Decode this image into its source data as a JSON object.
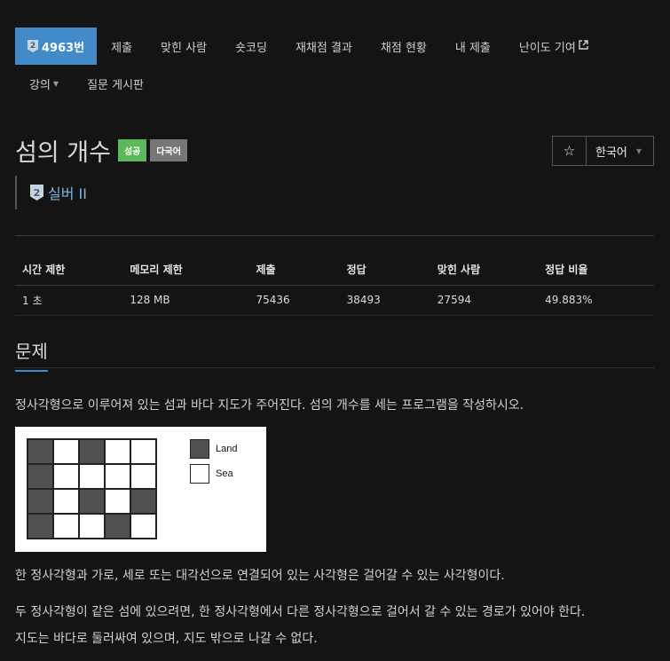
{
  "nav": {
    "problem_number": "4963번",
    "tier_number": "2",
    "items": [
      "제출",
      "맞힌 사람",
      "숏코딩",
      "재채점 결과",
      "채점 현황",
      "내 제출",
      "난이도 기여"
    ],
    "external_icon": "external-link-icon",
    "second_row": [
      "강의",
      "질문 게시판"
    ]
  },
  "title": {
    "text": "섬의 개수",
    "label_success": "성공",
    "label_multi": "다국어"
  },
  "language": {
    "star": "☆",
    "current": "한국어"
  },
  "tier": {
    "badge": "2",
    "name": "실버 II"
  },
  "stats": {
    "headers": [
      "시간 제한",
      "메모리 제한",
      "제출",
      "정답",
      "맞힌 사람",
      "정답 비율"
    ],
    "values": [
      "1 초",
      "128 MB",
      "75436",
      "38493",
      "27594",
      "49.883%"
    ]
  },
  "section": {
    "title": "문제"
  },
  "description": {
    "p1": "정사각형으로 이루어져 있는 섬과 바다 지도가 주어진다. 섬의 개수를 세는 프로그램을 작성하시오.",
    "p2": "한 정사각형과 가로, 세로 또는 대각선으로 연결되어 있는 사각형은 걸어갈 수 있는 사각형이다.",
    "p3": "두 정사각형이 같은 섬에 있으려면, 한 정사각형에서 다른 정사각형으로 걸어서 갈 수 있는 경로가 있어야 한다.",
    "p4": "지도는 바다로 둘러싸여 있으며, 지도 밖으로 나갈 수 없다."
  },
  "figure": {
    "grid": [
      [
        1,
        0,
        1,
        0,
        0
      ],
      [
        1,
        0,
        0,
        0,
        0
      ],
      [
        1,
        0,
        1,
        0,
        1
      ],
      [
        1,
        0,
        0,
        1,
        0
      ]
    ],
    "legend_land": "Land",
    "legend_sea": "Sea",
    "land_color": "#505050",
    "sea_color": "#ffffff"
  }
}
